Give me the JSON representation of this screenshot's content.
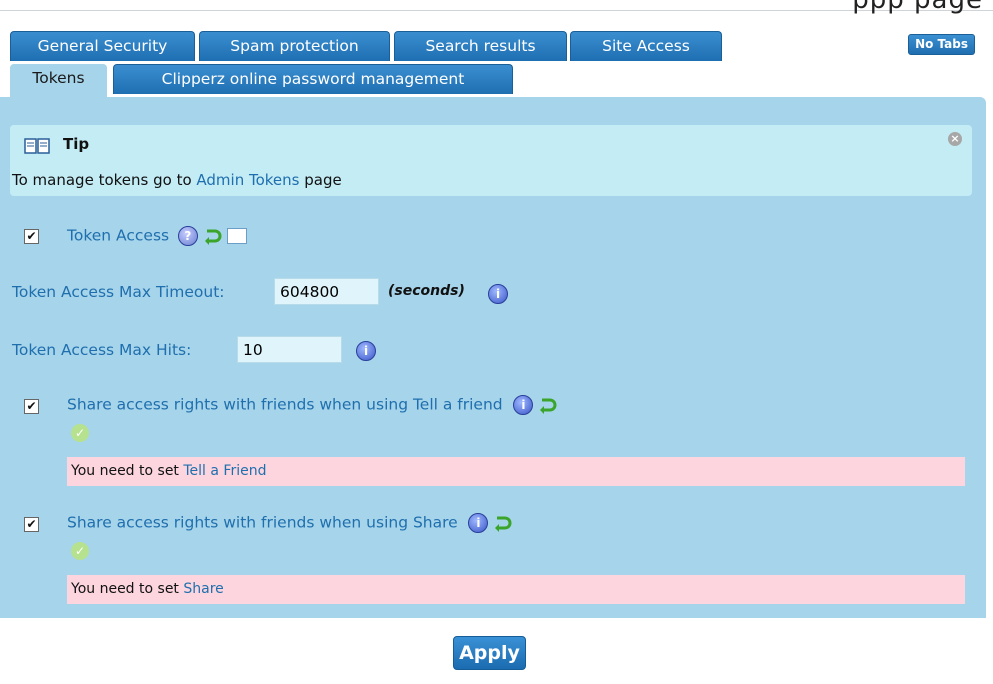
{
  "page": {
    "cut_title": "ppp page"
  },
  "tabs_row1": [
    {
      "label": "General Security"
    },
    {
      "label": "Spam protection"
    },
    {
      "label": "Search results"
    },
    {
      "label": "Site Access"
    }
  ],
  "tabs_row2": [
    {
      "label": "Tokens",
      "active": true
    },
    {
      "label": "Clipperz online password management"
    }
  ],
  "no_tabs_label": "No Tabs",
  "tip": {
    "title": "Tip",
    "text_prefix": "To manage tokens go to ",
    "link": "Admin Tokens",
    "text_suffix": " page",
    "close_icon": "close-icon"
  },
  "options": {
    "token_access": {
      "label": "Token Access",
      "checked": true
    },
    "max_timeout": {
      "label": "Token Access Max Timeout:",
      "value": "604800",
      "unit": "(seconds)"
    },
    "max_hits": {
      "label": "Token Access Max Hits:",
      "value": "10"
    },
    "share_tell_friend": {
      "label": "Share access rights with friends when using Tell a friend",
      "checked": true,
      "warning_prefix": "You need to set ",
      "warning_link": "Tell a Friend"
    },
    "share_share": {
      "label": "Share access rights with friends when using Share",
      "checked": true,
      "warning_prefix": "You need to set ",
      "warning_link": "Share"
    }
  },
  "apply_label": "Apply",
  "colors": {
    "tab_blue": "#1e6fb2",
    "panel": "#a6d4ea",
    "tip_bg": "#c4ecf5",
    "warning_bg": "#fcd5de",
    "link": "#1f6fae"
  }
}
